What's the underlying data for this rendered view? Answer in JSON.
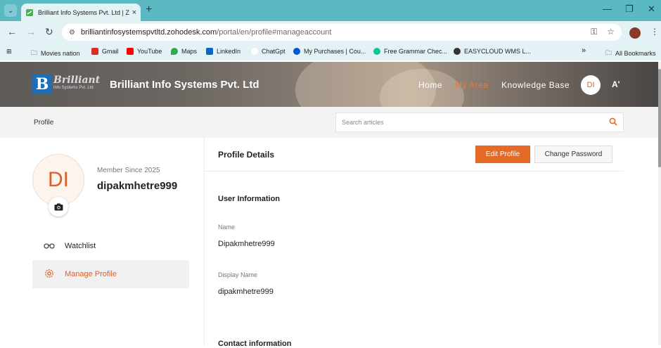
{
  "browser": {
    "tab_title": "Brilliant Info Systems Pvt. Ltd | Z",
    "tab_close": "×",
    "new_tab": "+",
    "url_host": "brilliantinfosystemspvtltd.zohodesk.com",
    "url_path": "/portal/en/profile#manageaccount",
    "window_minimize": "—",
    "window_restore": "❐",
    "window_close": "✕"
  },
  "bookmarks": {
    "items": [
      {
        "label": "Movies nation",
        "icon": "folder-icon",
        "color": "#e3f3f5"
      },
      {
        "label": "Gmail",
        "icon": "gmail-icon",
        "color": "#d93025"
      },
      {
        "label": "YouTube",
        "icon": "youtube-icon",
        "color": "#ff0000"
      },
      {
        "label": "Maps",
        "icon": "maps-icon",
        "color": "#34a853"
      },
      {
        "label": "LinkedIn",
        "icon": "linkedin-icon",
        "color": "#0a66c2"
      },
      {
        "label": "ChatGpt",
        "icon": "chatgpt-icon",
        "color": "#ffffff"
      },
      {
        "label": "My Purchases | Cou...",
        "icon": "coursera-icon",
        "color": "#0056d2"
      },
      {
        "label": "Free Grammar Chec...",
        "icon": "grammar-icon",
        "color": "#15c39a"
      },
      {
        "label": "EASYCLOUD WMS L...",
        "icon": "globe-icon",
        "color": "#333333"
      }
    ],
    "overflow": "»",
    "all_bookmarks": "All Bookmarks"
  },
  "site": {
    "logo_word": "Brilliant",
    "logo_sub": "Info Systems Pvt. Ltd",
    "logo_letter": "B",
    "brand_name": "Brilliant Info Systems Pvt. Ltd",
    "nav": {
      "home": "Home",
      "my_area": "My Area",
      "knowledge_base": "Knowledge Base"
    },
    "avatar_initials": "DI",
    "font_toggle": "A'",
    "accent_color": "#e56a26"
  },
  "subheader": {
    "crumb": "Profile",
    "search_placeholder": "Search articles"
  },
  "profile": {
    "initials": "DI",
    "member_since": "Member Since 2025",
    "username": "dipakmhetre999",
    "menu": [
      {
        "label": "Watchlist",
        "icon": "glasses-icon"
      },
      {
        "label": "Manage Profile",
        "icon": "gear-icon"
      }
    ]
  },
  "details": {
    "title": "Profile Details",
    "edit_label": "Edit Profile",
    "change_password_label": "Change Password",
    "section_user": "User Information",
    "name_label": "Name",
    "name_value": "Dipakmhetre999",
    "display_name_label": "Display Name",
    "display_name_value": "dipakmhetre999",
    "section_contact": "Contact information"
  }
}
